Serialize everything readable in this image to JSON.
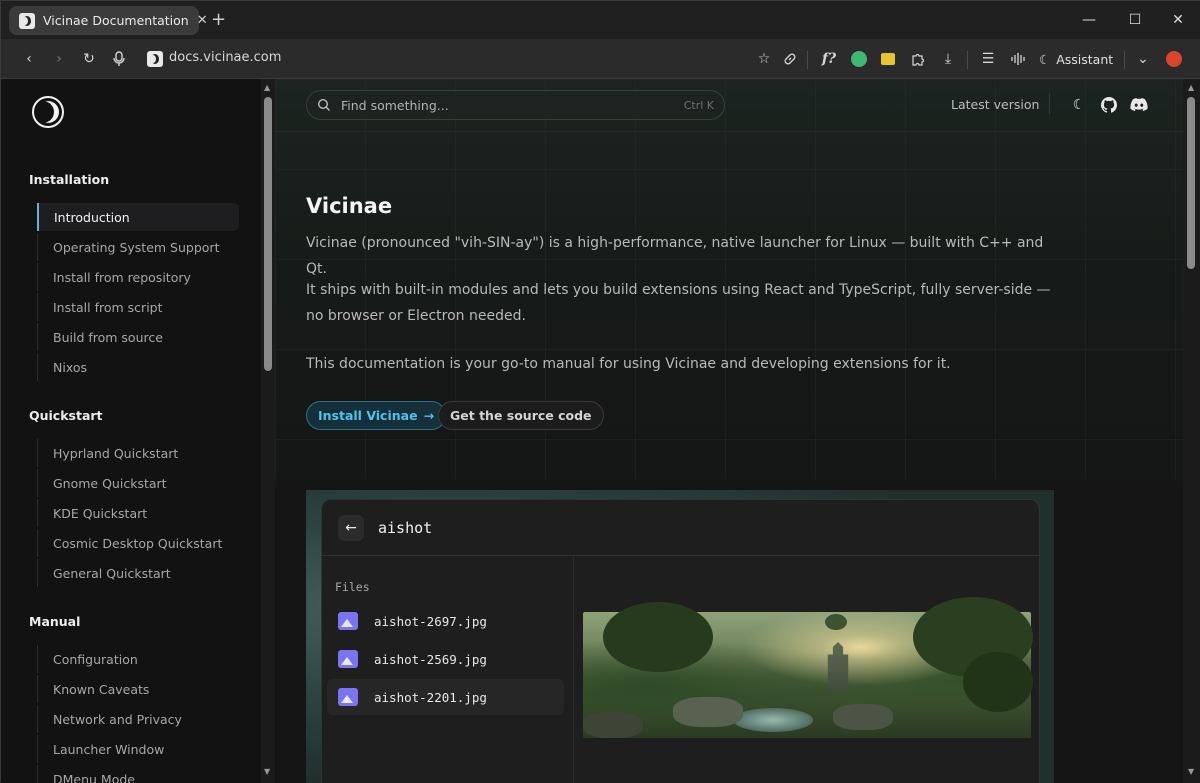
{
  "browser": {
    "tab_title": "Vicinae Documentation",
    "tab_close": "✕",
    "new_tab": "+",
    "url": "docs.vicinae.com",
    "assistant_label": "Assistant",
    "controls": {
      "minimize": "—",
      "maximize": "☐",
      "close": "✕"
    }
  },
  "docs": {
    "search_placeholder": "Find something...",
    "search_shortcut": "Ctrl K",
    "latest_version": "Latest version",
    "sidebar": {
      "sections": [
        {
          "title": "Installation",
          "items": [
            "Introduction",
            "Operating System Support",
            "Install from repository",
            "Install from script",
            "Build from source",
            "Nixos"
          ]
        },
        {
          "title": "Quickstart",
          "items": [
            "Hyprland Quickstart",
            "Gnome Quickstart",
            "KDE Quickstart",
            "Cosmic Desktop Quickstart",
            "General Quickstart"
          ]
        },
        {
          "title": "Manual",
          "items": [
            "Configuration",
            "Known Caveats",
            "Network and Privacy",
            "Launcher Window",
            "DMenu Mode"
          ]
        }
      ],
      "active_item": "Introduction"
    },
    "content": {
      "heading": "Vicinae",
      "paragraphs": [
        "Vicinae (pronounced \"vih-SIN-ay\") is a high-performance, native launcher for Linux — built with C++ and Qt.",
        "It ships with built-in modules and lets you build extensions using React and TypeScript, fully server-side — no browser or Electron needed.",
        "This documentation is your go-to manual for using Vicinae and developing extensions for it."
      ],
      "primary_button": "Install Vicinae",
      "primary_arrow": "→",
      "secondary_button": "Get the source code"
    },
    "demo": {
      "query": "aishot",
      "section_label": "Files",
      "files": [
        "aishot-2697.jpg",
        "aishot-2569.jpg",
        "aishot-2201.jpg"
      ],
      "selected_index": 2
    }
  },
  "colors": {
    "accent": "#4fc3ec",
    "active_indicator": "#6fb0d9",
    "file_icon": "#7b74f0"
  }
}
